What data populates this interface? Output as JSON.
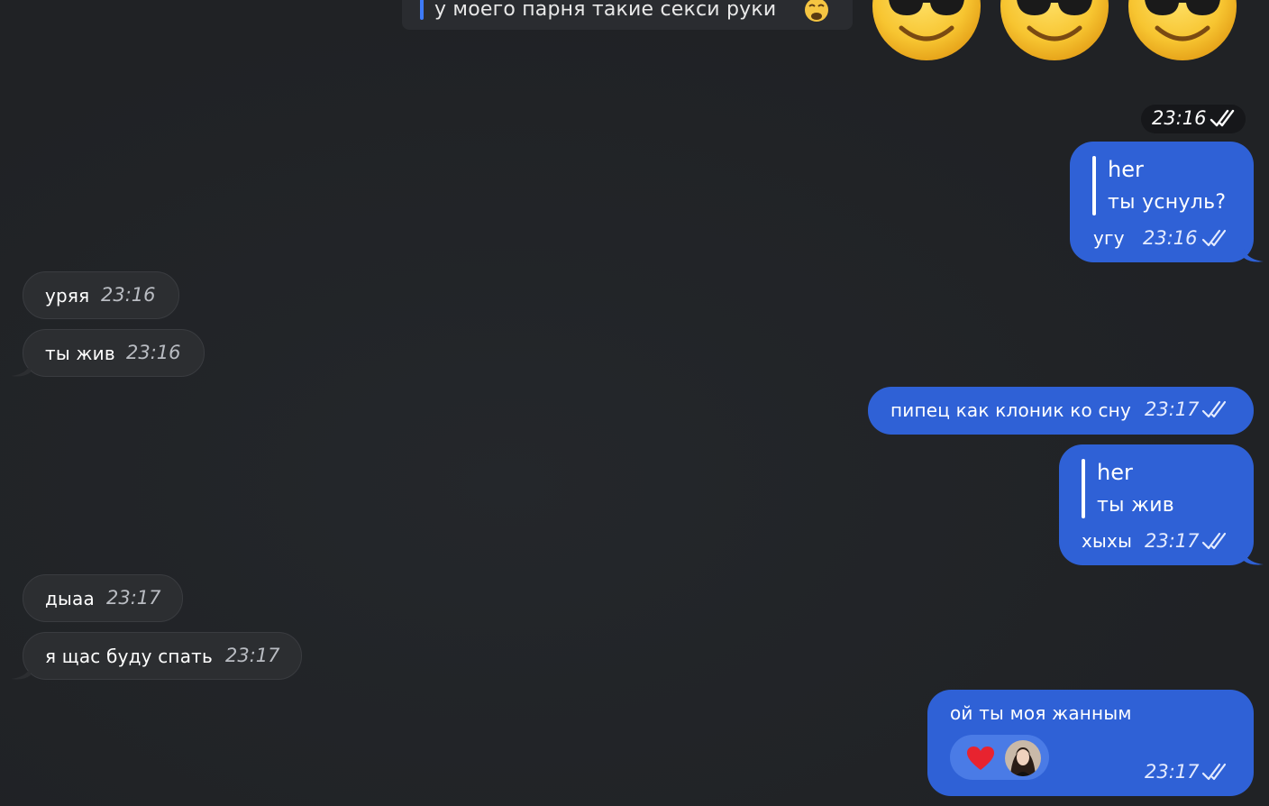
{
  "top_reply": {
    "text": "у моего парня такие секси руки",
    "emoji_icon": "weary-face-icon"
  },
  "sticker": {
    "emoji_count": 3,
    "emoji_icon": "smiling-face-with-sunglasses-icon",
    "time": "23:16",
    "status_icon": "double-check-icon"
  },
  "messages": [
    {
      "direction": "out",
      "reply_name": "her",
      "reply_text": "ты уснуль?",
      "text": "угу",
      "time": "23:16",
      "status_icon": "double-check-icon"
    },
    {
      "direction": "in",
      "text": "уряя",
      "time": "23:16"
    },
    {
      "direction": "in",
      "text": "ты жив",
      "time": "23:16"
    },
    {
      "direction": "out",
      "text": "пипец как клоник ко сну",
      "time": "23:17",
      "status_icon": "double-check-icon"
    },
    {
      "direction": "out",
      "reply_name": "her",
      "reply_text": "ты жив",
      "text": "хыхы",
      "time": "23:17",
      "status_icon": "double-check-icon"
    },
    {
      "direction": "in",
      "text": "дыаа",
      "time": "23:17"
    },
    {
      "direction": "in",
      "text": "я щас буду спать",
      "time": "23:17"
    },
    {
      "direction": "out",
      "text": "ой ты моя жанным",
      "time": "23:17",
      "status_icon": "double-check-icon",
      "reaction": {
        "emoji_icon": "red-heart-icon",
        "avatar": "reactor-avatar"
      }
    }
  ],
  "colors": {
    "background": "#212326",
    "incoming_bubble": "#2c2e31",
    "outgoing_bubble": "#2f61d6",
    "reply_accent": "#3e7bfa",
    "heart": "#e8232f"
  }
}
